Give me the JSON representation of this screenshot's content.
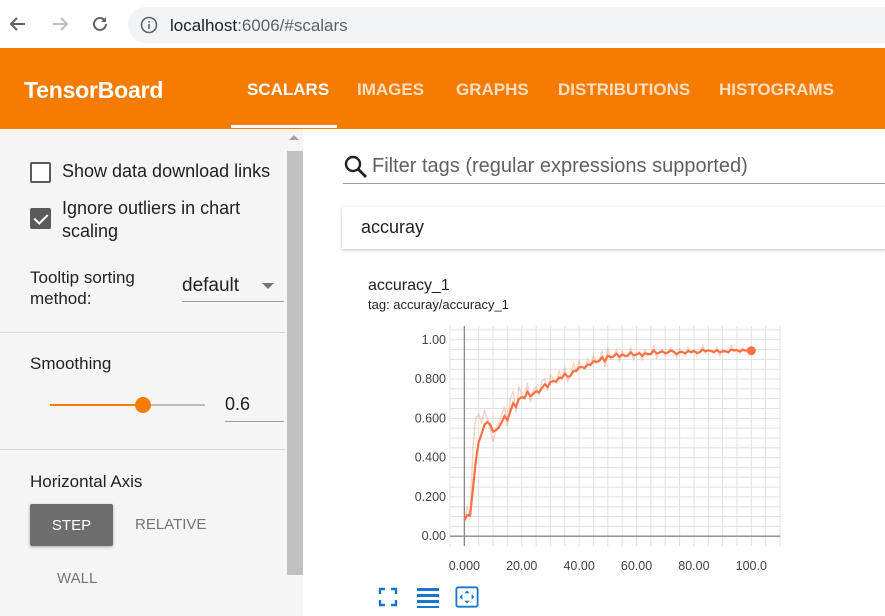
{
  "browser": {
    "url_host": "localhost",
    "url_path": ":6006/#scalars"
  },
  "header": {
    "title": "TensorBoard",
    "tabs": [
      {
        "label": "SCALARS",
        "active": true
      },
      {
        "label": "IMAGES",
        "active": false
      },
      {
        "label": "GRAPHS",
        "active": false
      },
      {
        "label": "DISTRIBUTIONS",
        "active": false
      },
      {
        "label": "HISTOGRAMS",
        "active": false
      }
    ],
    "color": "#f57c00"
  },
  "sidebar": {
    "show_download_label": "Show data download links",
    "show_download_checked": false,
    "ignore_outliers_line1": "Ignore outliers in chart",
    "ignore_outliers_line2": "scaling",
    "ignore_outliers_checked": true,
    "tooltip_label_line1": "Tooltip sorting",
    "tooltip_label_line2": "method:",
    "tooltip_value": "default",
    "smoothing_label": "Smoothing",
    "smoothing_value": "0.6",
    "smoothing_fraction": 0.6,
    "horizontal_axis_label": "Horizontal Axis",
    "axis_buttons": {
      "step": "STEP",
      "relative": "RELATIVE",
      "wall": "WALL"
    },
    "axis_selected": "STEP"
  },
  "main": {
    "filter_placeholder": "Filter tags (regular expressions supported)",
    "category_title": "accuray",
    "card": {
      "title": "accuracy_1",
      "tag": "tag: accuray/accuracy_1"
    }
  },
  "chart_data": {
    "type": "line",
    "title": "",
    "xlabel": "",
    "ylabel": "",
    "xlim": [
      -5,
      110
    ],
    "ylim": [
      -0.05,
      1.07
    ],
    "x_ticks": [
      "0.000",
      "20.00",
      "40.00",
      "60.00",
      "80.00",
      "100.0"
    ],
    "x_tick_values": [
      0,
      20,
      40,
      60,
      80,
      100
    ],
    "y_ticks": [
      "0.00",
      "0.200",
      "0.400",
      "0.600",
      "0.800",
      "1.00"
    ],
    "y_tick_values": [
      0,
      0.2,
      0.4,
      0.6,
      0.8,
      1.0
    ],
    "grid": true,
    "series": [
      {
        "color": "#ff7043",
        "raw_x": [
          0,
          1,
          2,
          3,
          4,
          5,
          6,
          7,
          8,
          9,
          10,
          11,
          12,
          13,
          14,
          15,
          16,
          17,
          18,
          19,
          20,
          21,
          22,
          23,
          24,
          25,
          26,
          27,
          28,
          29,
          30,
          31,
          32,
          33,
          34,
          35,
          36,
          37,
          38,
          39,
          40,
          41,
          42,
          43,
          44,
          45,
          46,
          47,
          48,
          49,
          50,
          51,
          52,
          53,
          54,
          55,
          56,
          57,
          58,
          59,
          60,
          61,
          62,
          63,
          64,
          65,
          66,
          67,
          68,
          69,
          70,
          71,
          72,
          73,
          74,
          75,
          76,
          77,
          78,
          79,
          80,
          81,
          82,
          83,
          84,
          85,
          86,
          87,
          88,
          89,
          90,
          91,
          92,
          93,
          94,
          95,
          96,
          97,
          98,
          99,
          100
        ],
        "raw_y": [
          0.08,
          0.15,
          0.1,
          0.45,
          0.6,
          0.62,
          0.58,
          0.64,
          0.6,
          0.55,
          0.48,
          0.55,
          0.57,
          0.62,
          0.66,
          0.56,
          0.7,
          0.74,
          0.63,
          0.76,
          0.72,
          0.7,
          0.78,
          0.68,
          0.74,
          0.76,
          0.72,
          0.79,
          0.8,
          0.74,
          0.82,
          0.8,
          0.78,
          0.84,
          0.8,
          0.86,
          0.79,
          0.82,
          0.88,
          0.84,
          0.89,
          0.86,
          0.85,
          0.9,
          0.87,
          0.92,
          0.88,
          0.9,
          0.94,
          0.86,
          0.96,
          0.9,
          0.92,
          0.95,
          0.89,
          0.94,
          0.91,
          0.92,
          0.96,
          0.9,
          0.93,
          0.94,
          0.9,
          0.95,
          0.92,
          0.93,
          0.97,
          0.91,
          0.94,
          0.95,
          0.92,
          0.94,
          0.96,
          0.93,
          0.91,
          0.95,
          0.94,
          0.92,
          0.96,
          0.93,
          0.95,
          0.92,
          0.94,
          0.97,
          0.93,
          0.95,
          0.94,
          0.93,
          0.96,
          0.92,
          0.95,
          0.94,
          0.93,
          0.97,
          0.94,
          0.95,
          0.93,
          0.96,
          0.94,
          0.95,
          0.94
        ],
        "smoothing": 0.6
      }
    ]
  },
  "toolbar": {
    "icons": [
      "fullscreen-icon",
      "toggle-log-scale-icon",
      "fit-domain-icon"
    ]
  }
}
